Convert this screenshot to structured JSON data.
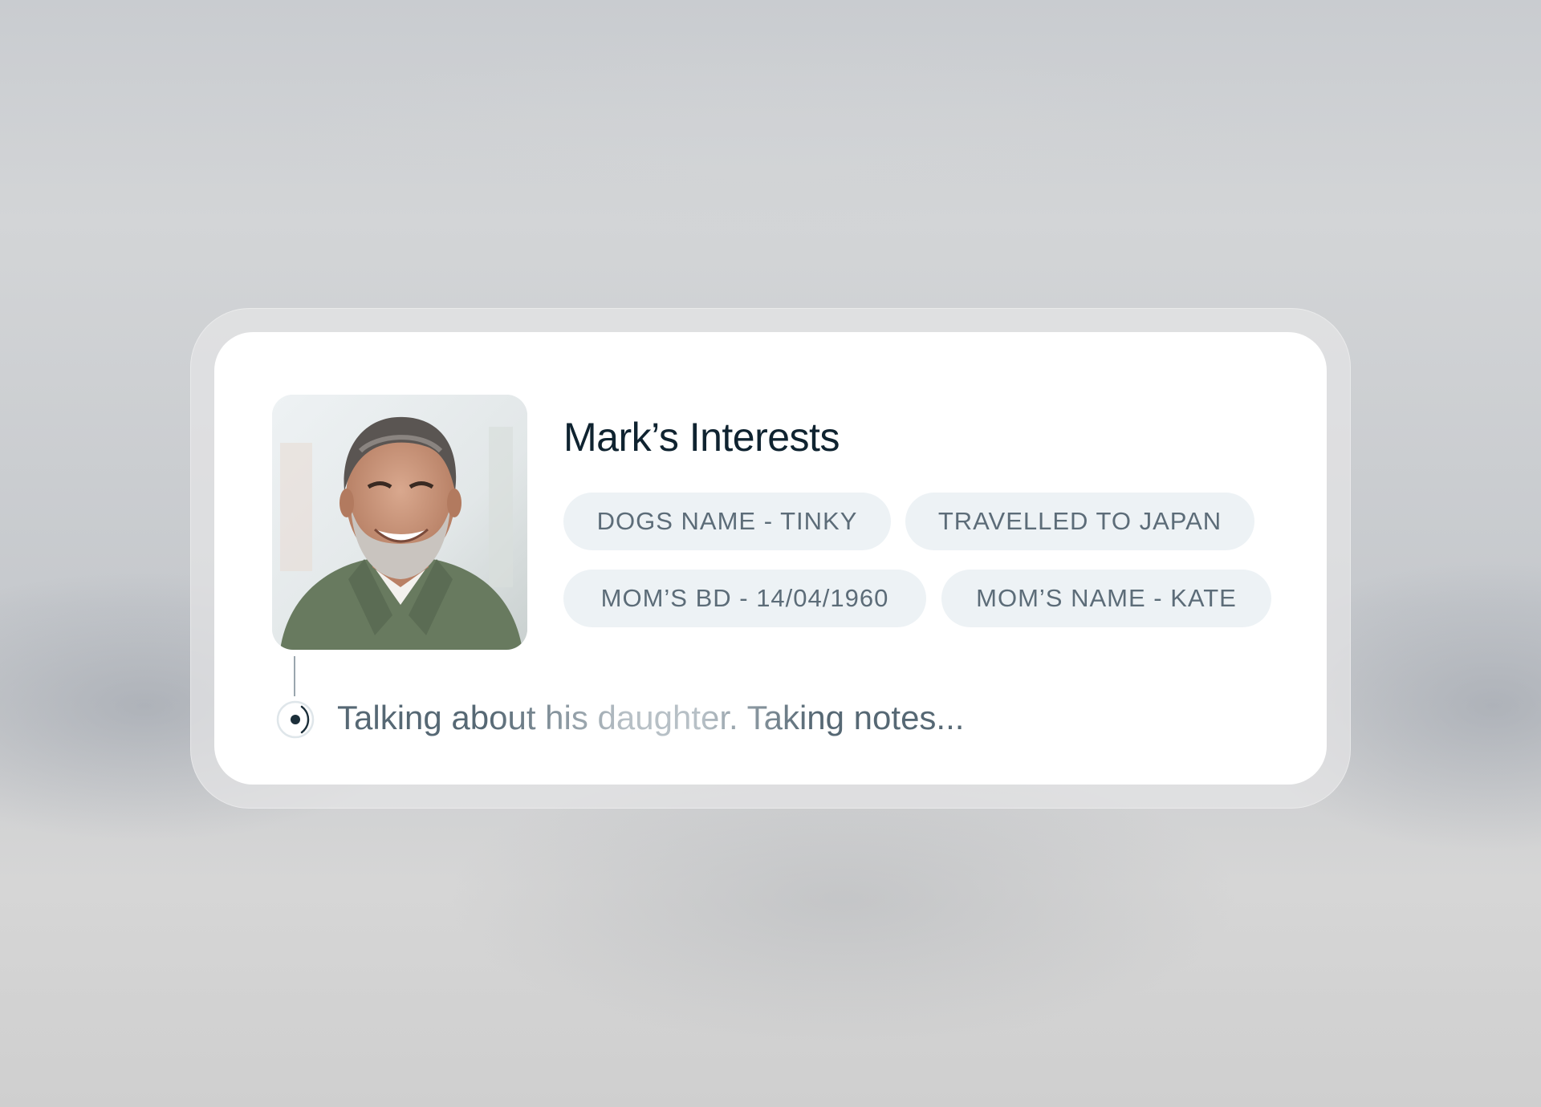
{
  "card": {
    "title": "Mark’s Interests",
    "photo_alt": "Portrait of Mark"
  },
  "interests": [
    {
      "label": "DOGS NAME - TINKY"
    },
    {
      "label": "TRAVELLED TO JAPAN"
    },
    {
      "label": "MOM’S BD - 14/04/1960"
    },
    {
      "label": "MOM’S NAME - KATE"
    }
  ],
  "status": {
    "text": "Talking about his daughter. Taking notes...",
    "icon": "recording-dot-icon"
  },
  "colors": {
    "title": "#0f2330",
    "chip_bg": "#edf2f5",
    "chip_text": "#5c6c78",
    "status_text": "#566874"
  }
}
